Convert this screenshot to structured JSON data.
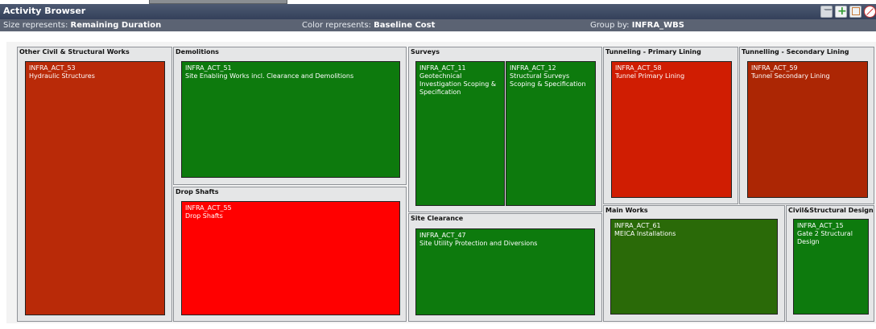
{
  "window": {
    "title": "Activity Browser",
    "buttons": [
      "filter-icon",
      "add-icon",
      "copy-icon",
      "close-icon"
    ]
  },
  "info": {
    "size_label": "Size represents:",
    "size_value": "Remaining Duration",
    "color_label": "Color represents:",
    "color_value": "Baseline Cost",
    "group_label": "Group by:",
    "group_value": "INFRA_WBS"
  },
  "groups": [
    {
      "title": "Other Civil & Structural Works",
      "tiles": [
        {
          "id": "INFRA_ACT_53",
          "name": "Hydraulic Structures",
          "color": "#b92a08"
        }
      ]
    },
    {
      "title": "Demolitions",
      "tiles": [
        {
          "id": "INFRA_ACT_51",
          "name": "Site Enabling Works incl. Clearance and Demolitions",
          "color": "#0d7a0d"
        }
      ]
    },
    {
      "title": "Drop Shafts",
      "tiles": [
        {
          "id": "INFRA_ACT_55",
          "name": "Drop Shafts",
          "color": "#ff0000"
        }
      ]
    },
    {
      "title": "Surveys",
      "tiles": [
        {
          "id": "INFRA_ACT_11",
          "name": "Geotechnical Investigation Scoping & Specification",
          "color": "#0d7a0d"
        },
        {
          "id": "INFRA_ACT_12",
          "name": "Structural Surveys Scoping & Specification",
          "color": "#0d7a0d"
        }
      ]
    },
    {
      "title": "Site Clearance",
      "tiles": [
        {
          "id": "INFRA_ACT_47",
          "name": "Site Utility Protection and Diversions",
          "color": "#0d7a0d"
        }
      ]
    },
    {
      "title": "Tunneling - Primary Lining",
      "tiles": [
        {
          "id": "INFRA_ACT_58",
          "name": "Tunnel Primary Lining",
          "color": "#d01d02"
        }
      ]
    },
    {
      "title": "Tunnelling - Secondary Lining",
      "tiles": [
        {
          "id": "INFRA_ACT_59",
          "name": "Tunnel Secondary Lining",
          "color": "#ac2604"
        }
      ]
    },
    {
      "title": "Main Works",
      "tiles": [
        {
          "id": "INFRA_ACT_61",
          "name": "MEICA Installations",
          "color": "#2a6a08"
        }
      ]
    },
    {
      "title": "Civil&Structural Design",
      "tiles": [
        {
          "id": "INFRA_ACT_15",
          "name": "Gate 2 Structural Design",
          "color": "#0d7a0d"
        }
      ]
    }
  ]
}
